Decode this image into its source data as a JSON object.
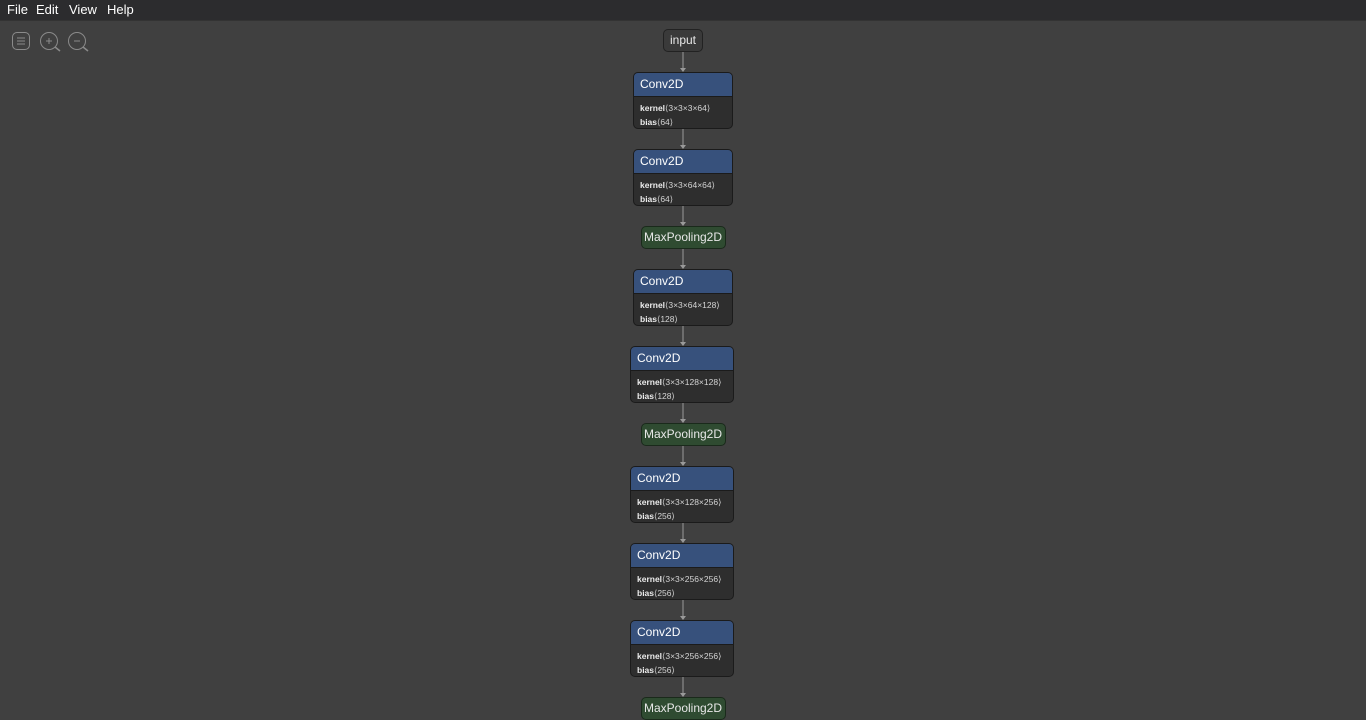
{
  "menubar": {
    "file": "File",
    "edit": "Edit",
    "view": "View",
    "help": "Help"
  },
  "toolbar": {
    "icons": [
      "sidebar-icon",
      "zoom-in-icon",
      "zoom-out-icon"
    ]
  },
  "graph": {
    "input_label": "input",
    "nodes": [
      {
        "type": "Conv2D",
        "kernel_name": "kernel",
        "kernel": "⟨3×3×3×64⟩",
        "bias_name": "bias",
        "bias": "⟨64⟩"
      },
      {
        "type": "Conv2D",
        "kernel_name": "kernel",
        "kernel": "⟨3×3×64×64⟩",
        "bias_name": "bias",
        "bias": "⟨64⟩"
      },
      {
        "type": "MaxPooling2D"
      },
      {
        "type": "Conv2D",
        "kernel_name": "kernel",
        "kernel": "⟨3×3×64×128⟩",
        "bias_name": "bias",
        "bias": "⟨128⟩"
      },
      {
        "type": "Conv2D",
        "kernel_name": "kernel",
        "kernel": "⟨3×3×128×128⟩",
        "bias_name": "bias",
        "bias": "⟨128⟩"
      },
      {
        "type": "MaxPooling2D"
      },
      {
        "type": "Conv2D",
        "kernel_name": "kernel",
        "kernel": "⟨3×3×128×256⟩",
        "bias_name": "bias",
        "bias": "⟨256⟩"
      },
      {
        "type": "Conv2D",
        "kernel_name": "kernel",
        "kernel": "⟨3×3×256×256⟩",
        "bias_name": "bias",
        "bias": "⟨256⟩"
      },
      {
        "type": "Conv2D",
        "kernel_name": "kernel",
        "kernel": "⟨3×3×256×256⟩",
        "bias_name": "bias",
        "bias": "⟨256⟩"
      },
      {
        "type": "MaxPooling2D"
      }
    ]
  },
  "colors": {
    "conv_header": "#37517c",
    "pool": "#2f4b31",
    "canvas": "#404040"
  }
}
